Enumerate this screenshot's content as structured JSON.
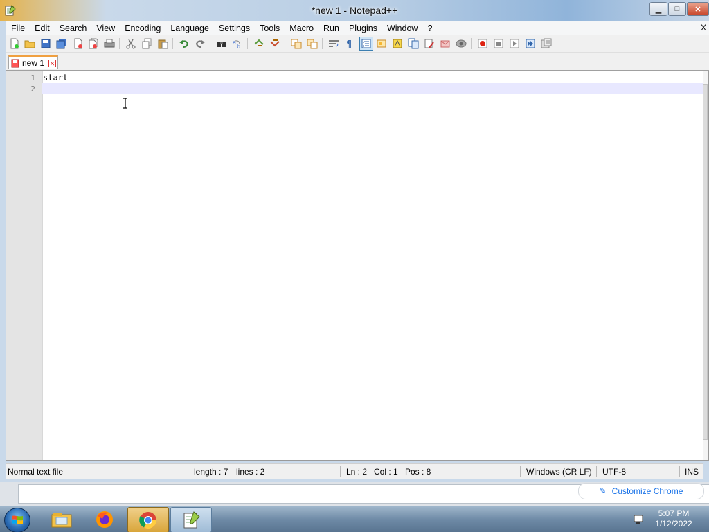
{
  "window": {
    "title": "*new 1 - Notepad++",
    "controls": {
      "minimize": "▁",
      "maximize": "□",
      "close": "✕"
    }
  },
  "menu": {
    "items": [
      "File",
      "Edit",
      "Search",
      "View",
      "Encoding",
      "Language",
      "Settings",
      "Tools",
      "Macro",
      "Run",
      "Plugins",
      "Window",
      "?"
    ],
    "close_glyph": "X"
  },
  "toolbar": {
    "icons": [
      "new-file-icon",
      "open-file-icon",
      "save-icon",
      "save-all-icon",
      "close-icon",
      "close-all-icon",
      "print-icon",
      "cut-icon",
      "copy-icon",
      "paste-icon",
      "undo-icon",
      "redo-icon",
      "find-icon",
      "replace-icon",
      "zoom-in-icon",
      "zoom-out-icon",
      "sync-vertical-icon",
      "sync-horizontal-icon",
      "word-wrap-icon",
      "show-all-chars-icon",
      "indent-guide-icon",
      "udl-icon",
      "doc-map-icon",
      "function-list-icon",
      "folder-as-workspace-icon",
      "monitoring-icon",
      "record-macro-icon",
      "stop-record-icon",
      "play-macro-icon",
      "run-macro-multiple-icon",
      "save-macro-icon"
    ]
  },
  "tabs": [
    {
      "label": "new 1",
      "modified": true
    }
  ],
  "editor": {
    "lines": [
      {
        "number": "1",
        "text": "start"
      },
      {
        "number": "2",
        "text": ""
      }
    ],
    "current_line": 2
  },
  "status": {
    "file_type": "Normal text file",
    "length": "length : 7",
    "lines": "lines : 2",
    "ln": "Ln : 2",
    "col": "Col : 1",
    "pos": "Pos : 8",
    "eol": "Windows (CR LF)",
    "encoding": "UTF-8",
    "mode": "INS"
  },
  "background_browser": {
    "chip_label": "Customize Chrome"
  },
  "taskbar": {
    "apps": [
      "explorer-icon",
      "firefox-icon",
      "chrome-icon",
      "notepadpp-icon"
    ],
    "time": "5:07 PM",
    "date": "1/12/2022"
  }
}
